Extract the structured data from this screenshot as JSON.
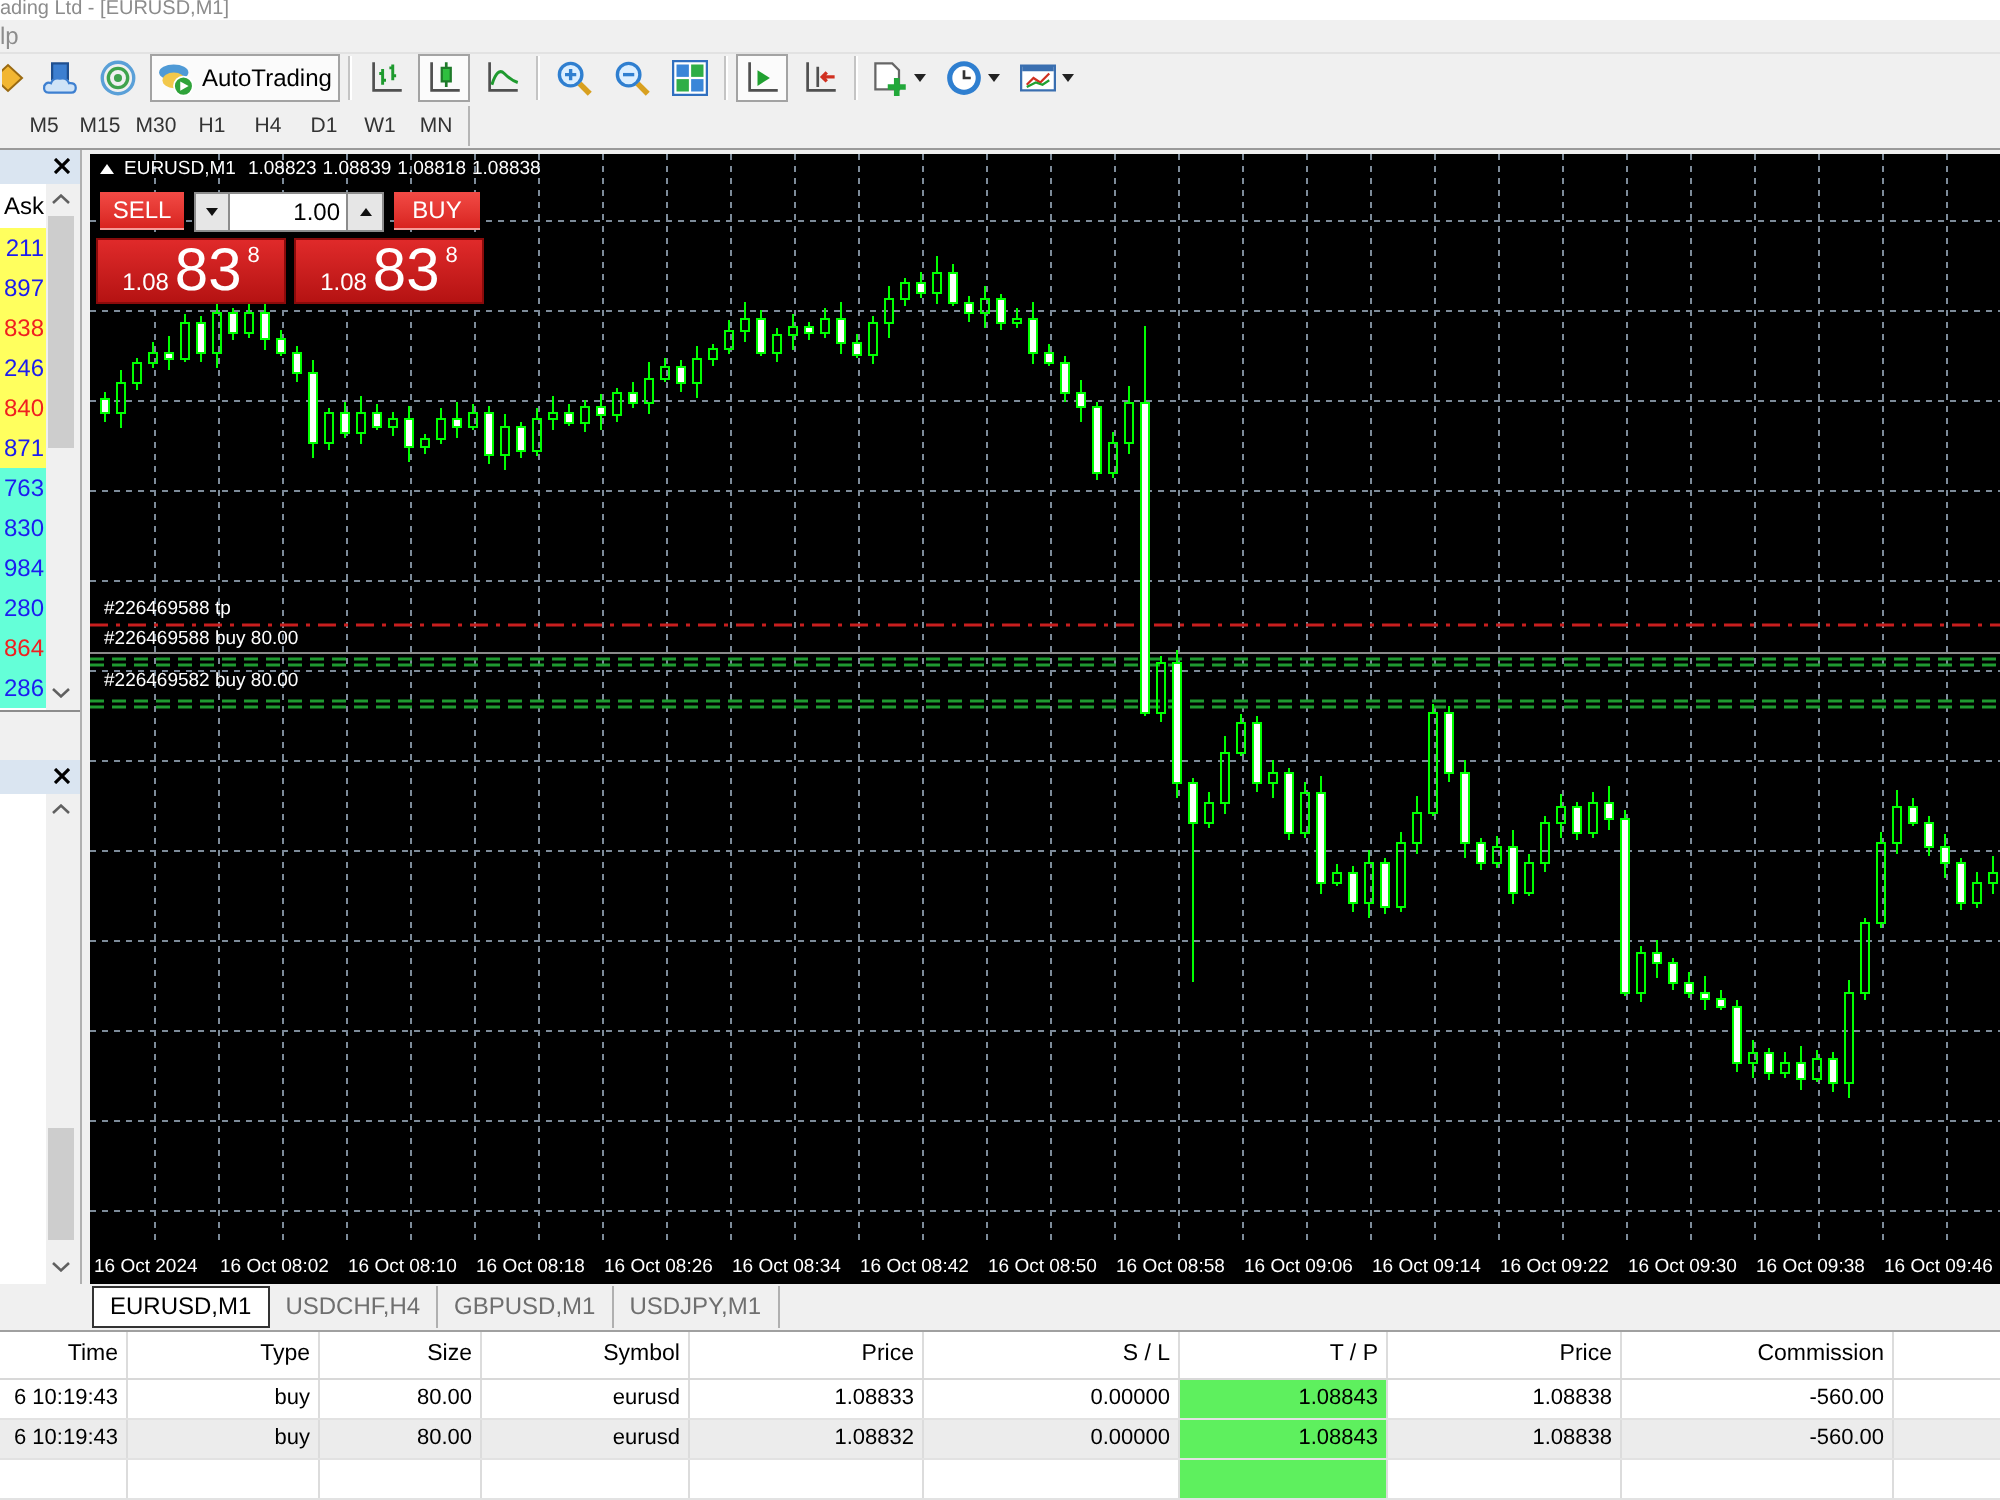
{
  "window": {
    "title": "ading Ltd - [EURUSD,M1]"
  },
  "menu": [
    "lp"
  ],
  "toolbar": [
    [
      {
        "kind": "icon",
        "pressed": false
      },
      {
        "kind": "icon",
        "pressed": false
      },
      {
        "kind": "icon",
        "pressed": false
      },
      {
        "kind": "label",
        "label": "AutoTrading",
        "pressed": true
      }
    ],
    [
      {
        "kind": "icon",
        "pressed": false
      },
      {
        "kind": "icon",
        "pressed": true
      },
      {
        "kind": "icon",
        "pressed": false
      }
    ],
    [
      {
        "kind": "icon",
        "pressed": false
      },
      {
        "kind": "icon",
        "pressed": false
      },
      {
        "kind": "icon",
        "pressed": false
      }
    ],
    [
      {
        "kind": "icon",
        "pressed": true
      },
      {
        "kind": "icon",
        "pressed": false
      }
    ],
    [
      {
        "kind": "menu",
        "pressed": false
      },
      {
        "kind": "menu",
        "pressed": false
      },
      {
        "kind": "menu",
        "pressed": false
      }
    ]
  ],
  "timeframes": [
    {
      "label": "M5",
      "selected": false
    },
    {
      "label": "M15",
      "selected": false
    },
    {
      "label": "M30",
      "selected": false
    },
    {
      "label": "H1",
      "selected": false
    },
    {
      "label": "H4",
      "selected": false
    },
    {
      "label": "D1",
      "selected": false
    },
    {
      "label": "W1",
      "selected": false
    },
    {
      "label": "MN",
      "selected": false
    }
  ],
  "market_watch": {
    "column": "Ask",
    "rows": [
      {
        "ask": "211",
        "color": "#1c1cf0",
        "fill": {
          "color": "#ffff5e"
        }
      },
      {
        "ask": "897",
        "color": "#1c1cf0",
        "fill": {
          "color": "#ffff5e"
        }
      },
      {
        "ask": "838",
        "color": "#f02020",
        "fill": {
          "color": "#ffff5e"
        }
      },
      {
        "ask": "246",
        "color": "#1c1cf0",
        "fill": {
          "color": "#ffff5e"
        }
      },
      {
        "ask": "840",
        "color": "#f02020",
        "fill": {
          "color": "#ffff5e"
        }
      },
      {
        "ask": "871",
        "color": "#1c1cf0",
        "fill": {
          "color": "#ffff5e"
        }
      },
      {
        "ask": "763",
        "color": "#1c1cf0",
        "fill": {
          "color": "#64ffd8"
        }
      },
      {
        "ask": "830",
        "color": "#1c1cf0",
        "fill": {
          "color": "#64ffd8"
        }
      },
      {
        "ask": "984",
        "color": "#1c1cf0",
        "fill": {
          "color": "#64ffd8"
        }
      },
      {
        "ask": "280",
        "color": "#1c1cf0",
        "fill": {
          "color": "#64ffd8"
        }
      },
      {
        "ask": "864",
        "color": "#f02020",
        "fill": {
          "color": "#64ffd8"
        }
      },
      {
        "ask": "286",
        "color": "#1c1cf0",
        "fill": {
          "color": "#64ffd8"
        }
      }
    ]
  },
  "chart": {
    "header": {
      "symbol": "EURUSD,M1",
      "values": [
        "1.08823",
        "1.08839",
        "1.08818",
        "1.08838"
      ]
    },
    "one_click": {
      "sell_label": "SELL",
      "buy_label": "BUY",
      "lot": "1.00",
      "sell_price": {
        "prefix": "1.08",
        "pips": "83",
        "point": "8"
      },
      "buy_price": {
        "prefix": "1.08",
        "pips": "83",
        "point": "8"
      }
    },
    "order_labels": [
      {
        "kind": "tp",
        "text": "#226469588 tp"
      },
      {
        "kind": "order",
        "text": "#226469588 buy 80.00"
      },
      {
        "kind": "order",
        "text": "#226469582 buy 80.00"
      }
    ],
    "time_axis": [
      "16 Oct 2024",
      "16 Oct 08:02",
      "16 Oct 08:10",
      "16 Oct 08:18",
      "16 Oct 08:26",
      "16 Oct 08:34",
      "16 Oct 08:42",
      "16 Oct 08:50",
      "16 Oct 08:58",
      "16 Oct 09:06",
      "16 Oct 09:14",
      "16 Oct 09:22",
      "16 Oct 09:30",
      "16 Oct 09:38",
      "16 Oct 09:46"
    ]
  },
  "chart_tabs": [
    {
      "label": "EURUSD,M1",
      "selected": true
    },
    {
      "label": "USDCHF,H4",
      "selected": false
    },
    {
      "label": "GBPUSD,M1",
      "selected": false
    },
    {
      "label": "USDJPY,M1",
      "selected": false
    }
  ],
  "trade_table": {
    "columns": [
      "Time",
      "Type",
      "Size",
      "Symbol",
      "Price",
      "S / L",
      "T / P",
      "Price",
      "Commission"
    ],
    "rows": [
      {
        "cells": [
          "6 10:19:43",
          "buy",
          "80.00",
          "eurusd",
          "1.08833",
          "0.00000",
          "1.08843",
          "1.08838",
          "-560.00"
        ],
        "tp_highlighted": true
      },
      {
        "cells": [
          "6 10:19:43",
          "buy",
          "80.00",
          "eurusd",
          "1.08832",
          "0.00000",
          "1.08843",
          "1.08838",
          "-560.00"
        ],
        "tp_highlighted": true
      },
      {
        "tp_highlighted": true
      }
    ]
  }
}
